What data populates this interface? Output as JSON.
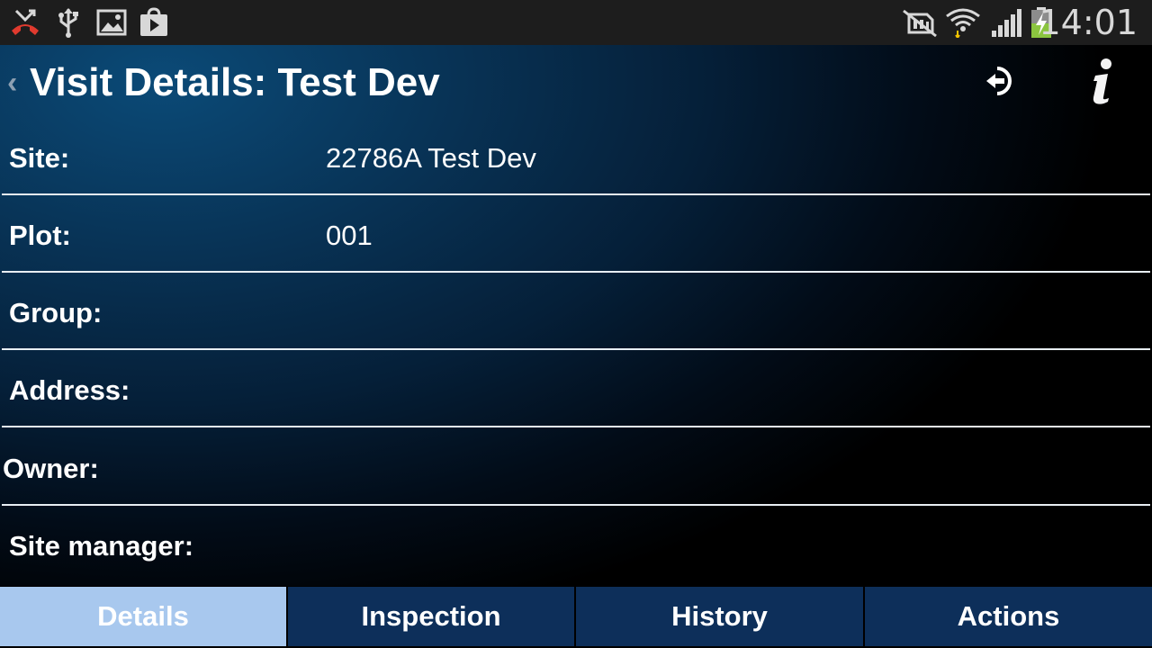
{
  "status_bar": {
    "icons_left": [
      "missed-call-icon",
      "usb-icon",
      "image-icon",
      "play-store-icon"
    ],
    "icons_right": [
      "no-sim-icon",
      "wifi-icon",
      "signal-icon",
      "battery-charging-icon"
    ],
    "time": "14:01"
  },
  "header": {
    "title": "Visit Details: Test Dev",
    "back_icon": "chevron-left-icon",
    "logout_icon": "logout-icon",
    "info_icon": "info-icon"
  },
  "details": [
    {
      "label": "Site:",
      "value": "22786A Test Dev"
    },
    {
      "label": "Plot:",
      "value": "001"
    },
    {
      "label": "Group:",
      "value": ""
    },
    {
      "label": "Address:",
      "value": ""
    },
    {
      "label": "Owner:",
      "value": ""
    },
    {
      "label": "Site manager:",
      "value": ""
    }
  ],
  "tabs": [
    {
      "label": "Details",
      "active": true
    },
    {
      "label": "Inspection",
      "active": false
    },
    {
      "label": "History",
      "active": false
    },
    {
      "label": "Actions",
      "active": false
    }
  ],
  "colors": {
    "active_tab": "#a8c8ee",
    "inactive_tab": "#0d2f5a",
    "missed_call": "#e03a2e",
    "battery_charge": "#8bc53f"
  }
}
